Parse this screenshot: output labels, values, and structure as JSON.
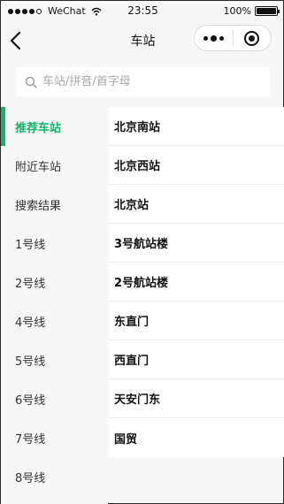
{
  "status_bar": {
    "carrier": "WeChat",
    "time": "23:55",
    "battery_text": "100%",
    "battery_level": 1.0
  },
  "nav": {
    "title": "车站",
    "back_icon": "chevron-left-icon",
    "more_icon": "more-dots-icon",
    "close_icon": "target-icon"
  },
  "search": {
    "placeholder": "车站/拼音/首字母",
    "value": "",
    "icon": "search-icon"
  },
  "sidebar": {
    "items": [
      {
        "label": "推荐车站",
        "active": true
      },
      {
        "label": "附近车站",
        "active": false
      },
      {
        "label": "搜索结果",
        "active": false
      },
      {
        "label": "1号线",
        "active": false
      },
      {
        "label": "2号线",
        "active": false
      },
      {
        "label": "4号线",
        "active": false
      },
      {
        "label": "5号线",
        "active": false
      },
      {
        "label": "6号线",
        "active": false
      },
      {
        "label": "7号线",
        "active": false
      },
      {
        "label": "8号线",
        "active": false
      }
    ]
  },
  "stations": {
    "items": [
      "北京南站",
      "北京西站",
      "北京站",
      "3号航站楼",
      "2号航站楼",
      "东直门",
      "西直门",
      "天安门东",
      "国贸"
    ]
  },
  "colors": {
    "accent": "#15b36b",
    "background": "#f7f7f7",
    "card": "#ffffff"
  }
}
